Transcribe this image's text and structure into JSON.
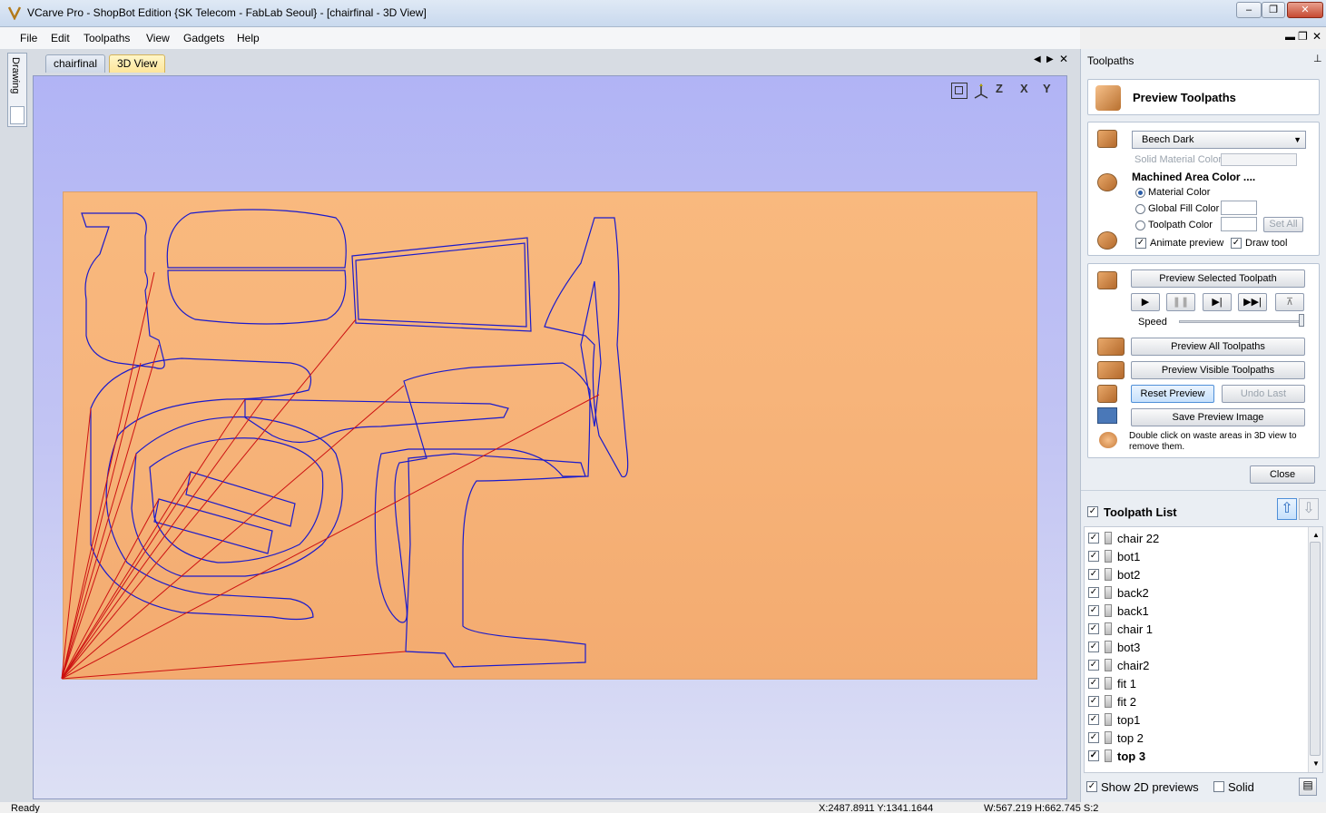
{
  "window": {
    "title": "VCarve Pro - ShopBot Edition {SK Telecom - FabLab Seoul} - [chairfinal - 3D View]"
  },
  "menu": {
    "file": "File",
    "edit": "Edit",
    "toolpaths": "Toolpaths",
    "view": "View",
    "gadgets": "Gadgets",
    "help": "Help"
  },
  "side_tab": {
    "drawing": "Drawing"
  },
  "tabs": {
    "chairfinal": "chairfinal",
    "view3d": "3D View"
  },
  "view_icons": {
    "fit": "fit-view-icon",
    "iso": "iso-view-icon",
    "z": "Z",
    "x": "X",
    "y": "Y"
  },
  "panel": {
    "header": "Toolpaths",
    "title": "Preview Toolpaths",
    "material": {
      "selected": "Beech Dark",
      "solid_color_label": "Solid Material Color",
      "machined_label": "Machined Area Color ....",
      "material_color": "Material Color",
      "global_fill": "Global Fill Color",
      "toolpath_color": "Toolpath Color",
      "set_all": "Set All",
      "animate": "Animate preview",
      "draw_tool": "Draw tool"
    },
    "preview": {
      "selected": "Preview Selected Toolpath",
      "speed": "Speed",
      "all": "Preview All Toolpaths",
      "visible": "Preview Visible Toolpaths",
      "reset": "Reset Preview",
      "undo": "Undo Last",
      "save": "Save Preview Image",
      "hint": "Double click on waste areas in 3D view to remove them."
    },
    "close": "Close",
    "list_title": "Toolpath List",
    "toolpaths": [
      {
        "name": "chair 22",
        "bold": false
      },
      {
        "name": "bot1",
        "bold": false
      },
      {
        "name": "bot2",
        "bold": false
      },
      {
        "name": "back2",
        "bold": false
      },
      {
        "name": "back1",
        "bold": false
      },
      {
        "name": "chair 1",
        "bold": false
      },
      {
        "name": "bot3",
        "bold": false
      },
      {
        "name": "chair2",
        "bold": false
      },
      {
        "name": "fit 1",
        "bold": false
      },
      {
        "name": "fit 2",
        "bold": false
      },
      {
        "name": "top1",
        "bold": false
      },
      {
        "name": "top 2",
        "bold": false
      },
      {
        "name": "top 3",
        "bold": true
      }
    ],
    "show_2d": "Show 2D previews",
    "solid": "Solid"
  },
  "status": {
    "ready": "Ready",
    "coords": "X:2487.8911 Y:1341.1644",
    "size": "W:567.219  H:662.745  S:2"
  },
  "colors": {
    "vector": "#1a1acc",
    "rapid": "#cc1111",
    "board": "#f7b47a",
    "bg_top": "#b1b4f5"
  }
}
